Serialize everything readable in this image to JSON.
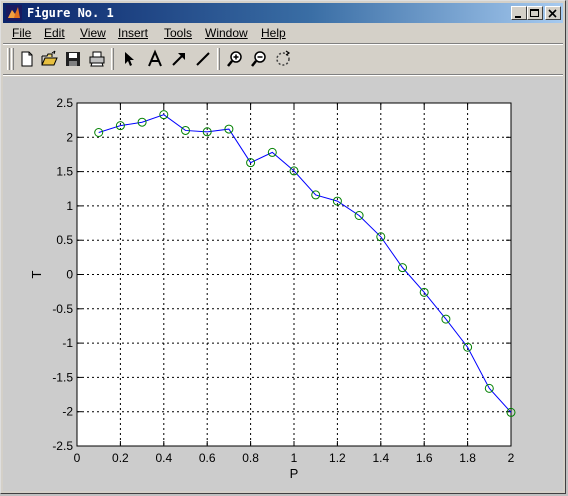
{
  "window": {
    "title": "Figure No. 1"
  },
  "menu": {
    "items": [
      {
        "label": "File"
      },
      {
        "label": "Edit"
      },
      {
        "label": "View"
      },
      {
        "label": "Insert"
      },
      {
        "label": "Tools"
      },
      {
        "label": "Window"
      },
      {
        "label": "Help"
      }
    ]
  },
  "toolbar": {
    "icons": [
      "new-file-icon",
      "open-folder-icon",
      "save-icon",
      "print-icon",
      "select-arrow-icon",
      "insert-text-icon",
      "insert-arrow-icon",
      "insert-line-icon",
      "zoom-in-icon",
      "zoom-out-icon",
      "rotate-icon"
    ]
  },
  "colors": {
    "line": "#0000ff",
    "marker": "#008000",
    "axes_bg": "#ffffff",
    "figure_bg": "#cccccc"
  },
  "chart_data": {
    "type": "line",
    "xlabel": "P",
    "ylabel": "T",
    "xlim": [
      0,
      2
    ],
    "ylim": [
      -2.5,
      2.5
    ],
    "xticks": [
      "0",
      "0.2",
      "0.4",
      "0.6",
      "0.8",
      "1",
      "1.2",
      "1.4",
      "1.6",
      "1.8",
      "2"
    ],
    "yticks": [
      "-2.5",
      "-2",
      "-1.5",
      "-1",
      "-0.5",
      "0",
      "0.5",
      "1",
      "1.5",
      "2",
      "2.5"
    ],
    "grid": true,
    "marker": "circle",
    "series": [
      {
        "x": [
          0.1,
          0.2,
          0.3,
          0.4,
          0.5,
          0.6,
          0.7,
          0.8,
          0.9,
          1.0,
          1.1,
          1.2,
          1.3,
          1.4,
          1.5,
          1.6,
          1.7,
          1.8,
          1.9,
          2.0
        ],
        "y": [
          2.07,
          2.17,
          2.22,
          2.33,
          2.1,
          2.08,
          2.12,
          1.63,
          1.78,
          1.51,
          1.16,
          1.07,
          0.86,
          0.55,
          0.1,
          -0.26,
          -0.65,
          -1.06,
          -1.66,
          -2.01
        ]
      }
    ]
  }
}
